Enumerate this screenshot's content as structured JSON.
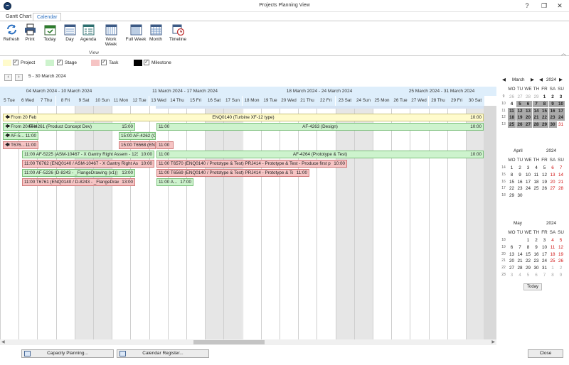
{
  "window": {
    "title": "Projects Planning View",
    "help_icon": "?",
    "maximize_glyph": "❐",
    "close_glyph": "✕"
  },
  "tabs": [
    {
      "label": "Gantt Chart"
    },
    {
      "label": "Calendar"
    }
  ],
  "ribbon": {
    "buttons": [
      {
        "label": "Refresh",
        "icon": "refresh-icon"
      },
      {
        "label": "Print",
        "icon": "print-icon"
      },
      {
        "label": "Today",
        "icon": "today-icon"
      },
      {
        "label": "Day",
        "icon": "day-view-icon"
      },
      {
        "label": "Agenda",
        "icon": "agenda-icon"
      },
      {
        "label": "Work Week",
        "icon": "work-week-icon"
      },
      {
        "label": "Full Week",
        "icon": "full-week-icon"
      },
      {
        "label": "Month",
        "icon": "month-icon"
      },
      {
        "label": "Timeline",
        "icon": "timeline-icon"
      }
    ],
    "group_label": "View"
  },
  "legend": [
    {
      "label": "Project",
      "color": "#fffbcc",
      "checked": true
    },
    {
      "label": "Stage",
      "color": "#cdf3cd",
      "checked": true
    },
    {
      "label": "Task",
      "color": "#f6c4c4",
      "checked": true
    },
    {
      "label": "Milestone",
      "color": "#000000",
      "checked": true
    }
  ],
  "range_label": "5 - 30 March 2024",
  "nav": {
    "prev": "‹",
    "next": "›"
  },
  "week_headers": [
    "04 March 2024 - 10 March 2024",
    "11 March 2024 - 17 March 2024",
    "18 March 2024 - 24 March 2024",
    "25 March 2024 - 31 March 2024"
  ],
  "days": [
    {
      "label": "5 Tue",
      "weekend": false
    },
    {
      "label": "6 Wed",
      "weekend": false
    },
    {
      "label": "7 Thu",
      "weekend": false
    },
    {
      "label": "8 Fri",
      "weekend": false
    },
    {
      "label": "9 Sat",
      "weekend": true
    },
    {
      "label": "10 Sun",
      "weekend": true
    },
    {
      "label": "11 Mon",
      "weekend": false
    },
    {
      "label": "12 Tue",
      "weekend": false
    },
    {
      "label": "13 Wed",
      "weekend": false
    },
    {
      "label": "14 Thu",
      "weekend": false
    },
    {
      "label": "15 Fri",
      "weekend": false
    },
    {
      "label": "16 Sat",
      "weekend": true
    },
    {
      "label": "17 Sun",
      "weekend": true
    },
    {
      "label": "18 Mon",
      "weekend": false
    },
    {
      "label": "19 Tue",
      "weekend": false
    },
    {
      "label": "20 Wed",
      "weekend": false
    },
    {
      "label": "21 Thu",
      "weekend": false
    },
    {
      "label": "22 Fri",
      "weekend": false
    },
    {
      "label": "23 Sat",
      "weekend": true
    },
    {
      "label": "24 Sun",
      "weekend": true
    },
    {
      "label": "25 Mon",
      "weekend": false
    },
    {
      "label": "26 Tue",
      "weekend": false
    },
    {
      "label": "27 Wed",
      "weekend": false
    },
    {
      "label": "28 Thu",
      "weekend": false
    },
    {
      "label": "29 Fri",
      "weekend": false
    },
    {
      "label": "30 Sat",
      "weekend": true
    }
  ],
  "events": [
    {
      "kind": "p",
      "start": "From 20 Feb",
      "center": "ENQ0140 (Turbine XF-12 type)",
      "end": "10:00"
    },
    {
      "kind": "s",
      "start": "From 20 Feb",
      "center": "AF-4261 (Product Concept Dev)",
      "end": "15:00"
    },
    {
      "kind": "s",
      "start": "11:00",
      "center": "AF-4263 (Design)",
      "end": "10:00"
    },
    {
      "kind": "s",
      "start": "AF-5...",
      "end": "11:00"
    },
    {
      "kind": "s",
      "start": "15:00 AF-4262 (C..."
    },
    {
      "kind": "t",
      "start": "T676...",
      "end": "11:00"
    },
    {
      "kind": "t",
      "start": "15:00 T6568 (ENQ..."
    },
    {
      "kind": "t",
      "start": "11:00"
    },
    {
      "kind": "s",
      "start": "11:00 AF-5225 (ASM-10467 - X Gantry Right Assem - 123",
      "end": "10:00"
    },
    {
      "kind": "s",
      "start": "11:00",
      "center": "AF-4264 (Prototype & Test)",
      "end": "10:00"
    },
    {
      "kind": "t",
      "start": "11:00 T6762 (ENQ0140 / ASM-10467 - X Gantry Right Asse...",
      "end": "10:00"
    },
    {
      "kind": "t",
      "start": "11:00 T6570 (ENQ0140 / Prototype & Test) PRJ414 - Prototype & Test - Produce first proto...",
      "end": "10:00"
    },
    {
      "kind": "s",
      "start": "11:00 AF-5226 (D-8243 - _FlangeDrawing (x1))",
      "end": "13:00"
    },
    {
      "kind": "t",
      "start": "11:00 T6569 (ENQ0140 / Prototype & Test) PRJ414 - Prototype & Test - Produce...",
      "end": "11:00"
    },
    {
      "kind": "t",
      "start": "11:00 T6761 (ENQ0140 / D-8243 - _FlangeDraw...",
      "end": "13:00"
    },
    {
      "kind": "s",
      "start": "11:00 A...",
      "end": "17:00"
    }
  ],
  "mini_calendars": [
    {
      "name": "march",
      "month": "March",
      "year": "2024",
      "has_nav": true,
      "dow": [
        "MO",
        "TU",
        "WE",
        "TH",
        "FR",
        "SA",
        "SU"
      ],
      "weeks": [
        "9",
        "10",
        "11",
        "12",
        "13"
      ],
      "rows": [
        [
          {
            "v": "26",
            "c": "dim"
          },
          {
            "v": "27",
            "c": "dim"
          },
          {
            "v": "28",
            "c": "dim"
          },
          {
            "v": "29",
            "c": "dim"
          },
          {
            "v": "1",
            "c": "bold"
          },
          {
            "v": "2",
            "c": "bold"
          },
          {
            "v": "3",
            "c": "bold"
          }
        ],
        [
          {
            "v": "4",
            "c": "bold"
          },
          {
            "v": "5",
            "c": "sel"
          },
          {
            "v": "6",
            "c": "sel"
          },
          {
            "v": "7",
            "c": "sel"
          },
          {
            "v": "8",
            "c": "sel"
          },
          {
            "v": "9",
            "c": "sel"
          },
          {
            "v": "10",
            "c": "sel"
          }
        ],
        [
          {
            "v": "11",
            "c": "sel"
          },
          {
            "v": "12",
            "c": "sel"
          },
          {
            "v": "13",
            "c": "sel"
          },
          {
            "v": "14",
            "c": "sel"
          },
          {
            "v": "15",
            "c": "sel"
          },
          {
            "v": "16",
            "c": "sel"
          },
          {
            "v": "17",
            "c": "sel"
          }
        ],
        [
          {
            "v": "18",
            "c": "sel"
          },
          {
            "v": "19",
            "c": "sel"
          },
          {
            "v": "20",
            "c": "sel"
          },
          {
            "v": "21",
            "c": "sel"
          },
          {
            "v": "22",
            "c": "sel"
          },
          {
            "v": "23",
            "c": "sel"
          },
          {
            "v": "24",
            "c": "sel"
          }
        ],
        [
          {
            "v": "25",
            "c": "sel"
          },
          {
            "v": "26",
            "c": "sel"
          },
          {
            "v": "27",
            "c": "sel"
          },
          {
            "v": "28",
            "c": "sel"
          },
          {
            "v": "29",
            "c": "sel"
          },
          {
            "v": "30",
            "c": "sel"
          },
          {
            "v": "31",
            "c": "red"
          }
        ]
      ]
    },
    {
      "name": "april",
      "month": "April",
      "year": "2024",
      "has_nav": false,
      "dow": [
        "MO",
        "TU",
        "WE",
        "TH",
        "FR",
        "SA",
        "SU"
      ],
      "weeks": [
        "14",
        "15",
        "16",
        "17",
        "18"
      ],
      "rows": [
        [
          {
            "v": "1",
            "c": ""
          },
          {
            "v": "2",
            "c": ""
          },
          {
            "v": "3",
            "c": ""
          },
          {
            "v": "4",
            "c": ""
          },
          {
            "v": "5",
            "c": ""
          },
          {
            "v": "6",
            "c": "red"
          },
          {
            "v": "7",
            "c": "red"
          }
        ],
        [
          {
            "v": "8",
            "c": ""
          },
          {
            "v": "9",
            "c": ""
          },
          {
            "v": "10",
            "c": ""
          },
          {
            "v": "11",
            "c": ""
          },
          {
            "v": "12",
            "c": ""
          },
          {
            "v": "13",
            "c": "red"
          },
          {
            "v": "14",
            "c": "red"
          }
        ],
        [
          {
            "v": "15",
            "c": ""
          },
          {
            "v": "16",
            "c": ""
          },
          {
            "v": "17",
            "c": ""
          },
          {
            "v": "18",
            "c": ""
          },
          {
            "v": "19",
            "c": ""
          },
          {
            "v": "20",
            "c": "red"
          },
          {
            "v": "21",
            "c": "red"
          }
        ],
        [
          {
            "v": "22",
            "c": ""
          },
          {
            "v": "23",
            "c": ""
          },
          {
            "v": "24",
            "c": ""
          },
          {
            "v": "25",
            "c": ""
          },
          {
            "v": "26",
            "c": ""
          },
          {
            "v": "27",
            "c": "red"
          },
          {
            "v": "28",
            "c": "red"
          }
        ],
        [
          {
            "v": "29",
            "c": ""
          },
          {
            "v": "30",
            "c": ""
          },
          {
            "v": "",
            "c": ""
          },
          {
            "v": "",
            "c": ""
          },
          {
            "v": "",
            "c": ""
          },
          {
            "v": "",
            "c": ""
          },
          {
            "v": "",
            "c": ""
          }
        ]
      ]
    },
    {
      "name": "may",
      "month": "May",
      "year": "2024",
      "has_nav": false,
      "dow": [
        "MO",
        "TU",
        "WE",
        "TH",
        "FR",
        "SA",
        "SU"
      ],
      "weeks": [
        "18",
        "19",
        "20",
        "21",
        "22",
        "23"
      ],
      "rows": [
        [
          {
            "v": "",
            "c": ""
          },
          {
            "v": "",
            "c": ""
          },
          {
            "v": "1",
            "c": ""
          },
          {
            "v": "2",
            "c": ""
          },
          {
            "v": "3",
            "c": ""
          },
          {
            "v": "4",
            "c": "red"
          },
          {
            "v": "5",
            "c": "red"
          }
        ],
        [
          {
            "v": "6",
            "c": ""
          },
          {
            "v": "7",
            "c": ""
          },
          {
            "v": "8",
            "c": ""
          },
          {
            "v": "9",
            "c": ""
          },
          {
            "v": "10",
            "c": ""
          },
          {
            "v": "11",
            "c": "red"
          },
          {
            "v": "12",
            "c": "red"
          }
        ],
        [
          {
            "v": "13",
            "c": ""
          },
          {
            "v": "14",
            "c": ""
          },
          {
            "v": "15",
            "c": ""
          },
          {
            "v": "16",
            "c": ""
          },
          {
            "v": "17",
            "c": ""
          },
          {
            "v": "18",
            "c": "red"
          },
          {
            "v": "19",
            "c": "red"
          }
        ],
        [
          {
            "v": "20",
            "c": ""
          },
          {
            "v": "21",
            "c": ""
          },
          {
            "v": "22",
            "c": ""
          },
          {
            "v": "23",
            "c": ""
          },
          {
            "v": "24",
            "c": ""
          },
          {
            "v": "25",
            "c": "red"
          },
          {
            "v": "26",
            "c": "red"
          }
        ],
        [
          {
            "v": "27",
            "c": ""
          },
          {
            "v": "28",
            "c": ""
          },
          {
            "v": "29",
            "c": ""
          },
          {
            "v": "30",
            "c": ""
          },
          {
            "v": "31",
            "c": ""
          },
          {
            "v": "1",
            "c": "dim"
          },
          {
            "v": "2",
            "c": "dim"
          }
        ],
        [
          {
            "v": "3",
            "c": "dim"
          },
          {
            "v": "4",
            "c": "dim"
          },
          {
            "v": "5",
            "c": "dim"
          },
          {
            "v": "6",
            "c": "dim"
          },
          {
            "v": "7",
            "c": "dim"
          },
          {
            "v": "8",
            "c": "dim"
          },
          {
            "v": "9",
            "c": "dim"
          }
        ]
      ]
    }
  ],
  "today_label": "Today",
  "bottom": {
    "capacity": "Capacity Planning...",
    "calendar_register": "Calendar Register...",
    "close": "Close"
  },
  "colors": {
    "accent": "#2a6fc0",
    "header_bg": "#deeefb",
    "weekend": "#e6e6e6",
    "project": "#fffbcc",
    "stage": "#cdf3cd",
    "task": "#f6c4c4",
    "selection": "#a9a9a9"
  }
}
